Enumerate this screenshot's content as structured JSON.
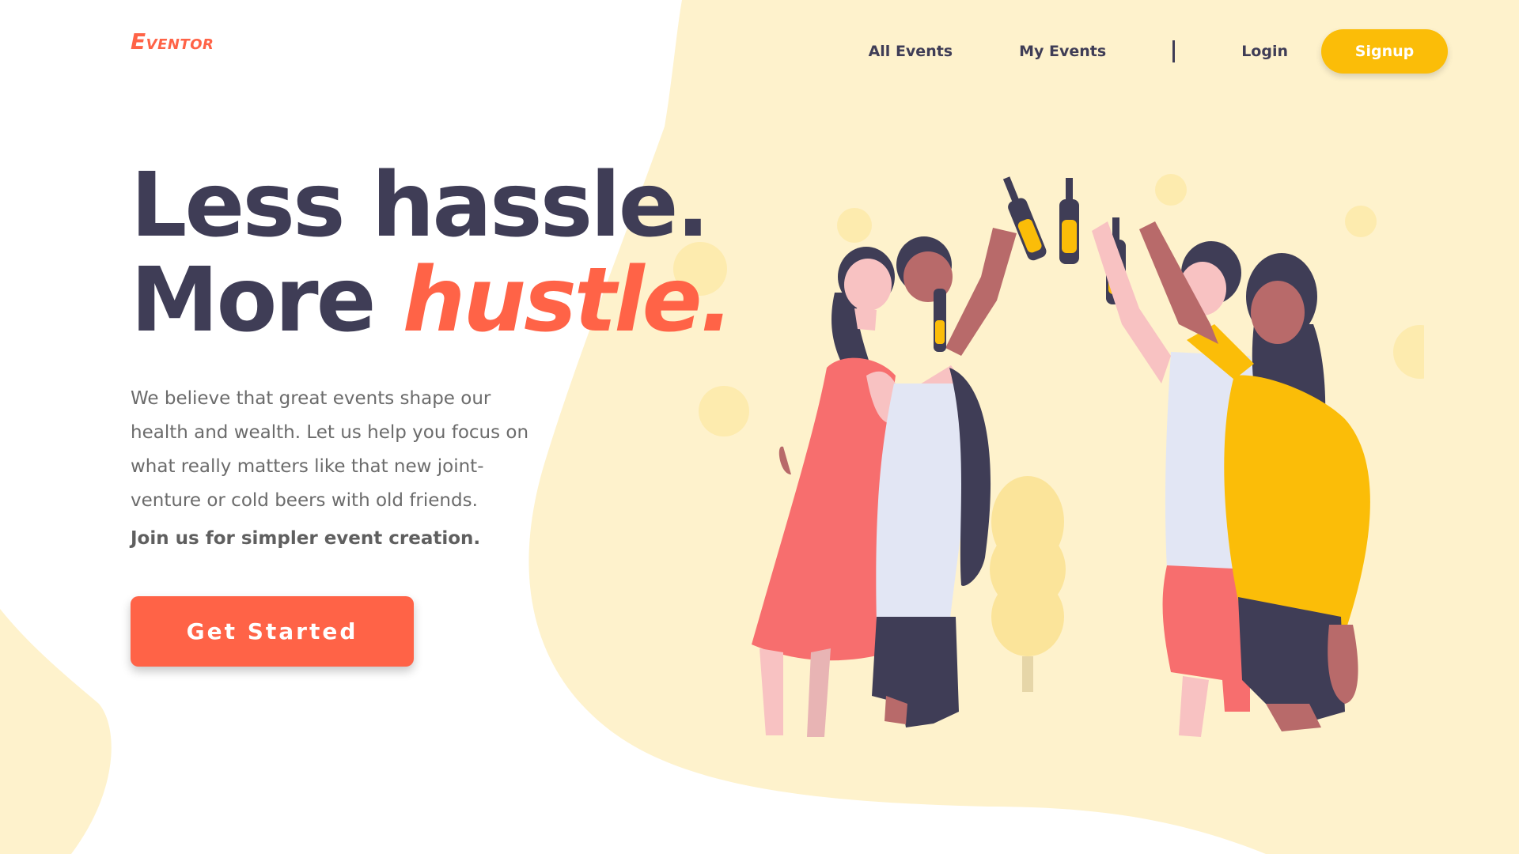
{
  "brand": {
    "cap": "E",
    "rest": "VENTOR"
  },
  "nav": {
    "all_events": "All Events",
    "my_events": "My Events",
    "login": "Login",
    "signup": "Signup"
  },
  "hero": {
    "line1": "Less hassle.",
    "line2_prefix": "More ",
    "line2_accent": "hustle.",
    "description": "We believe that great events shape our health and wealth. Let us help you focus on what really matters like that new joint-venture or cold beers with old friends.",
    "cta_text": "Join us for simpler event creation.",
    "button": "Get Started"
  },
  "colors": {
    "accent": "#ff6347",
    "dark": "#3f3d56",
    "yellow": "#fbbd08",
    "blob": "#fef2cc"
  },
  "illustration": {
    "icon": "friends-toasting-illustration"
  }
}
